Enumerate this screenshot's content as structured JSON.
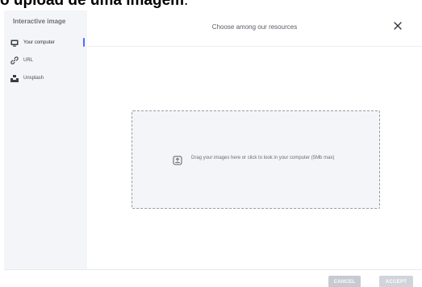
{
  "page_heading": {
    "bold": "o upload de uma imagem",
    "tail": "."
  },
  "modal": {
    "sidebar": {
      "title": "Interactive image",
      "items": [
        {
          "label": "Your computer",
          "icon": "computer-icon",
          "active": true
        },
        {
          "label": "URL",
          "icon": "link-icon",
          "active": false
        },
        {
          "label": "Unsplash",
          "icon": "unsplash-icon",
          "active": false
        }
      ]
    },
    "header": {
      "title": "Choose among our resources",
      "close_icon": "close-icon"
    },
    "dropzone": {
      "icon": "upload-file-icon",
      "text": "Drag your images here or click to look in your computer (5Mb max)"
    },
    "footer": {
      "cancel_label": "CANCEL",
      "accept_label": "ACCEPT"
    }
  },
  "colors": {
    "accent": "#4f6bff",
    "sidebar_bg": "#f4f5f8",
    "disabled_button": "#c8cad2"
  }
}
